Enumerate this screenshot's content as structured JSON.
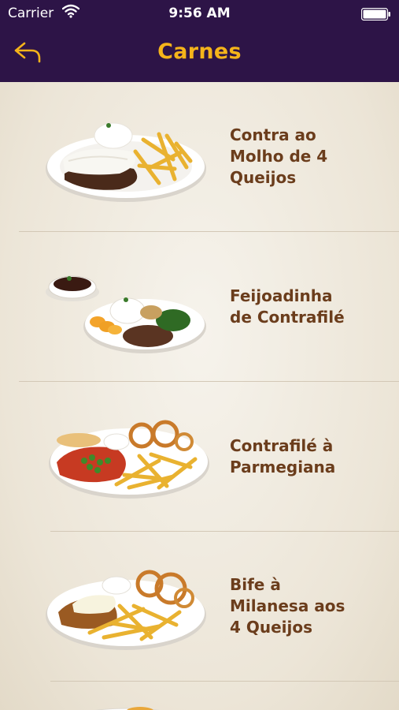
{
  "status_bar": {
    "carrier": "Carrier",
    "time": "9:56 AM"
  },
  "nav": {
    "title": "Carnes",
    "back_icon": "back-arrow-icon"
  },
  "colors": {
    "bar": "#2d1447",
    "title": "#f5b41a",
    "item_text": "#6b3d1c"
  },
  "items": [
    {
      "name": "Contra ao\nMolho de  4\nQueijos"
    },
    {
      "name": "Feijoadinha\nde Contrafilé"
    },
    {
      "name": "Contrafilé à\nParmegiana"
    },
    {
      "name": "Bife à\nMilanesa aos\n4 Queijos"
    }
  ]
}
